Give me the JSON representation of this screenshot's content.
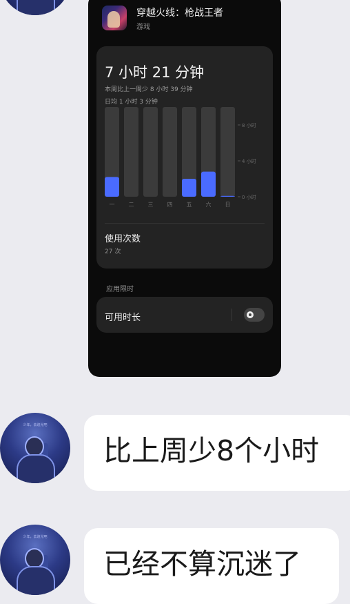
{
  "app": {
    "name": "穿越火线：枪战王者",
    "category": "游戏",
    "icon": "game-app-icon"
  },
  "usage": {
    "total": "7 小时 21 分钟",
    "compare": "本周比上一周少 8 小时 39 分钟",
    "daily_avg": "日均 1 小时 3 分钟",
    "use_count_title": "使用次数",
    "use_count": "27 次"
  },
  "chart_data": {
    "type": "bar",
    "categories": [
      "一",
      "二",
      "三",
      "四",
      "五",
      "六",
      "日"
    ],
    "values": [
      2.2,
      0,
      0,
      0,
      2.0,
      2.8,
      0.1
    ],
    "ylim": [
      0,
      10
    ],
    "ytick_labels": [
      "8 小时",
      "4 小时",
      "0 小时"
    ],
    "yticks": [
      8,
      4,
      0
    ],
    "bar_color": "#4a6bff",
    "track_color": "#3b3b3b"
  },
  "limits": {
    "section_label": "应用限时",
    "available_duration_label": "可用时长",
    "toggle_on": false
  },
  "chat": {
    "messages": [
      "比上周少8个小时",
      "已经不算沉迷了"
    ],
    "avatar_caption": "少年，去追光吧"
  }
}
